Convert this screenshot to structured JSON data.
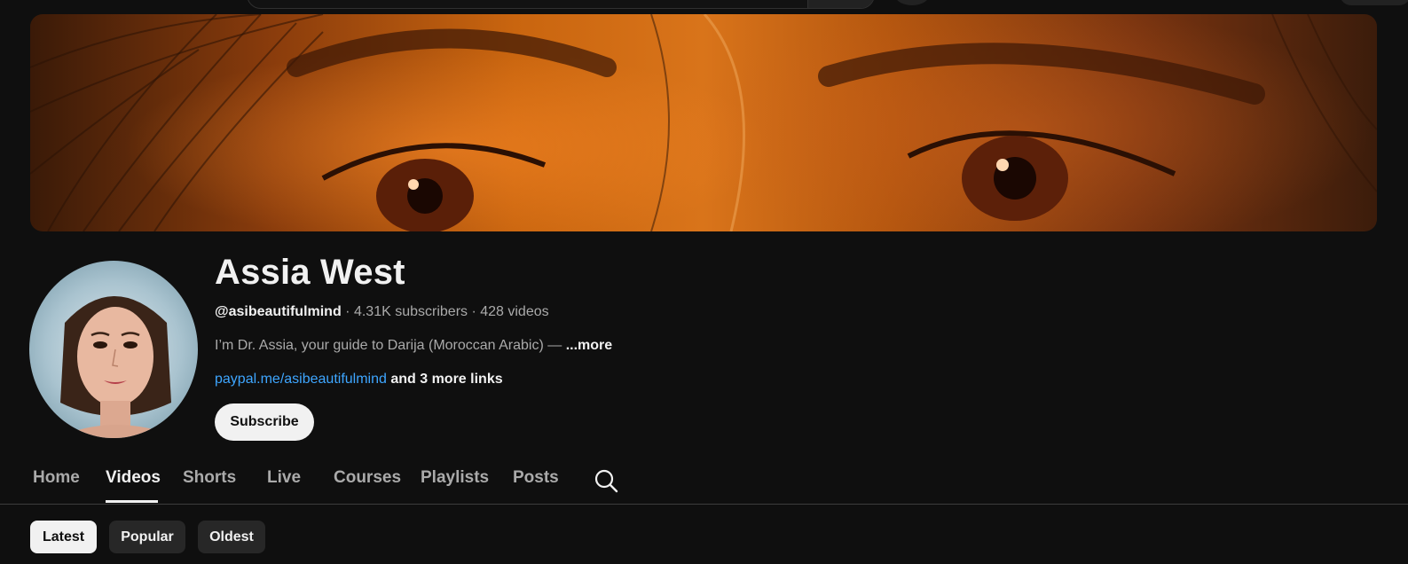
{
  "channel": {
    "name": "Assia West",
    "handle": "@asibeautifulmind",
    "subscribers": "4.31K subscribers",
    "videos": "428 videos",
    "separator": " · ",
    "description": "I’m Dr. Assia, your guide to Darija (Moroccan Arabic) — ",
    "description_more": "...more",
    "link": "paypal.me/asibeautifulmind",
    "more_links": "and 3 more links",
    "subscribe_label": "Subscribe"
  },
  "tabs": [
    {
      "label": "Home"
    },
    {
      "label": "Videos",
      "active": true
    },
    {
      "label": "Shorts"
    },
    {
      "label": "Live"
    },
    {
      "label": "Courses"
    },
    {
      "label": "Playlists"
    },
    {
      "label": "Posts"
    }
  ],
  "tab_search_icon": "search-icon",
  "filters": [
    {
      "label": "Latest",
      "selected": true
    },
    {
      "label": "Popular"
    },
    {
      "label": "Oldest"
    }
  ],
  "colors": {
    "background": "#0f0f0f",
    "text_primary": "#f1f1f1",
    "text_secondary": "#aaaaaa",
    "link": "#3ea6ff",
    "chip_bg": "#272727"
  }
}
